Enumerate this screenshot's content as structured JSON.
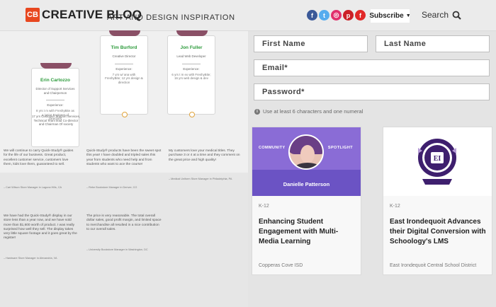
{
  "header": {
    "logo_mark": "CB",
    "logo_text": "CREATIVE BLOQ",
    "tagline": "ART AND DESIGN INSPIRATION",
    "social": [
      {
        "name": "facebook-icon",
        "glyph": "f",
        "color": "#3b5998"
      },
      {
        "name": "twitter-icon",
        "glyph": "t",
        "color": "#55acee"
      },
      {
        "name": "instagram-icon",
        "glyph": "◎",
        "color": "#e1306c"
      },
      {
        "name": "pinterest-icon",
        "glyph": "p",
        "color": "#cb2027"
      },
      {
        "name": "flipboard-icon",
        "glyph": "f",
        "color": "#e12828"
      }
    ],
    "subscribe_label": "Subscribe",
    "search_label": "Search"
  },
  "profiles": [
    {
      "name": "Erin Cartozzo",
      "role": "Director of Support Services and Chairperson",
      "exp_label": "Experience:",
      "exp_text": "8 yrs t m with FreshyBite as a junior Engineer of Directors"
    },
    {
      "name": "Tim Burford",
      "role": "Creative Director",
      "exp_label": "Experience:",
      "exp_text": "7 yrs w/ ana with FreshyBite; 12 yrs design & direction"
    },
    {
      "name": "Jon Fuller",
      "role": "Lead Web Developer",
      "exp_label": "Experience:",
      "exp_text": "6 yrs t m ex with FreshyBite; 16 yrs web design & dev"
    }
  ],
  "profile_overflow": "17 yrs Customer Support Services, Technical Team lead Co-director and Chairman Of society",
  "quotes": [
    {
      "text": "We will continue to carry Quick-Study® guides for the life of our business. Great product, excellent customer service, customers love them, kids love them, guaranteed to sell.",
      "attr": "– Cari Wilson Store Manager in Laguna Hills, CA"
    },
    {
      "text": "Quick-Study® products have been the sweet spot this year! I have doubled and tripled sales this year from students who need help and from students who want to ace the course!",
      "attr": "– Rebe Bookstore Manager in Denver, CO"
    },
    {
      "text": "My customers love your medical titles. They purchase 3 or 4 at a time and they comment on the great price and high quality!",
      "attr": "– Medical Uniform Store Manager in Philadelphia, PA"
    },
    {
      "text": "We have had the Quick-Study® display in our store less than a year now, and we have sold more than $1,600 worth of product. I was really surprised how well they sell. The display takes very little square footage and it goes great by the register!",
      "attr": "– Hardware Store Manager in Alexandria, VA"
    },
    {
      "text": "The price is very reasonable. The total overall dollar sales, good profit margin, and limited space to merchandise all resulted in a nice contribution to our overall sales.",
      "attr": "– University Bookstore Manager in Washington, DC"
    }
  ],
  "form": {
    "first_name": "First Name",
    "last_name": "Last Name",
    "email": "Email*",
    "password": "Password*",
    "hint": "Use at least 6 characters and one numeral"
  },
  "articles": [
    {
      "spot_left": "COMMUNITY",
      "spot_right": "SPOTLIGHT",
      "person": "Danielle Patterson",
      "category": "K-12",
      "title": "Enhancing Student Engagement with Multi-Media Learning",
      "source": "Copperas Cove ISD"
    },
    {
      "seal_text": "EAST IRONDEQUOIT",
      "category": "K-12",
      "title": "East Irondequoit Advances their Digital Conversion with Schoology's LMS",
      "source": "East Irondequoit Central School District"
    }
  ],
  "colors": {
    "brand": "#e8471f",
    "purple": "#6b53c4",
    "green_name": "#2b9a3a"
  }
}
